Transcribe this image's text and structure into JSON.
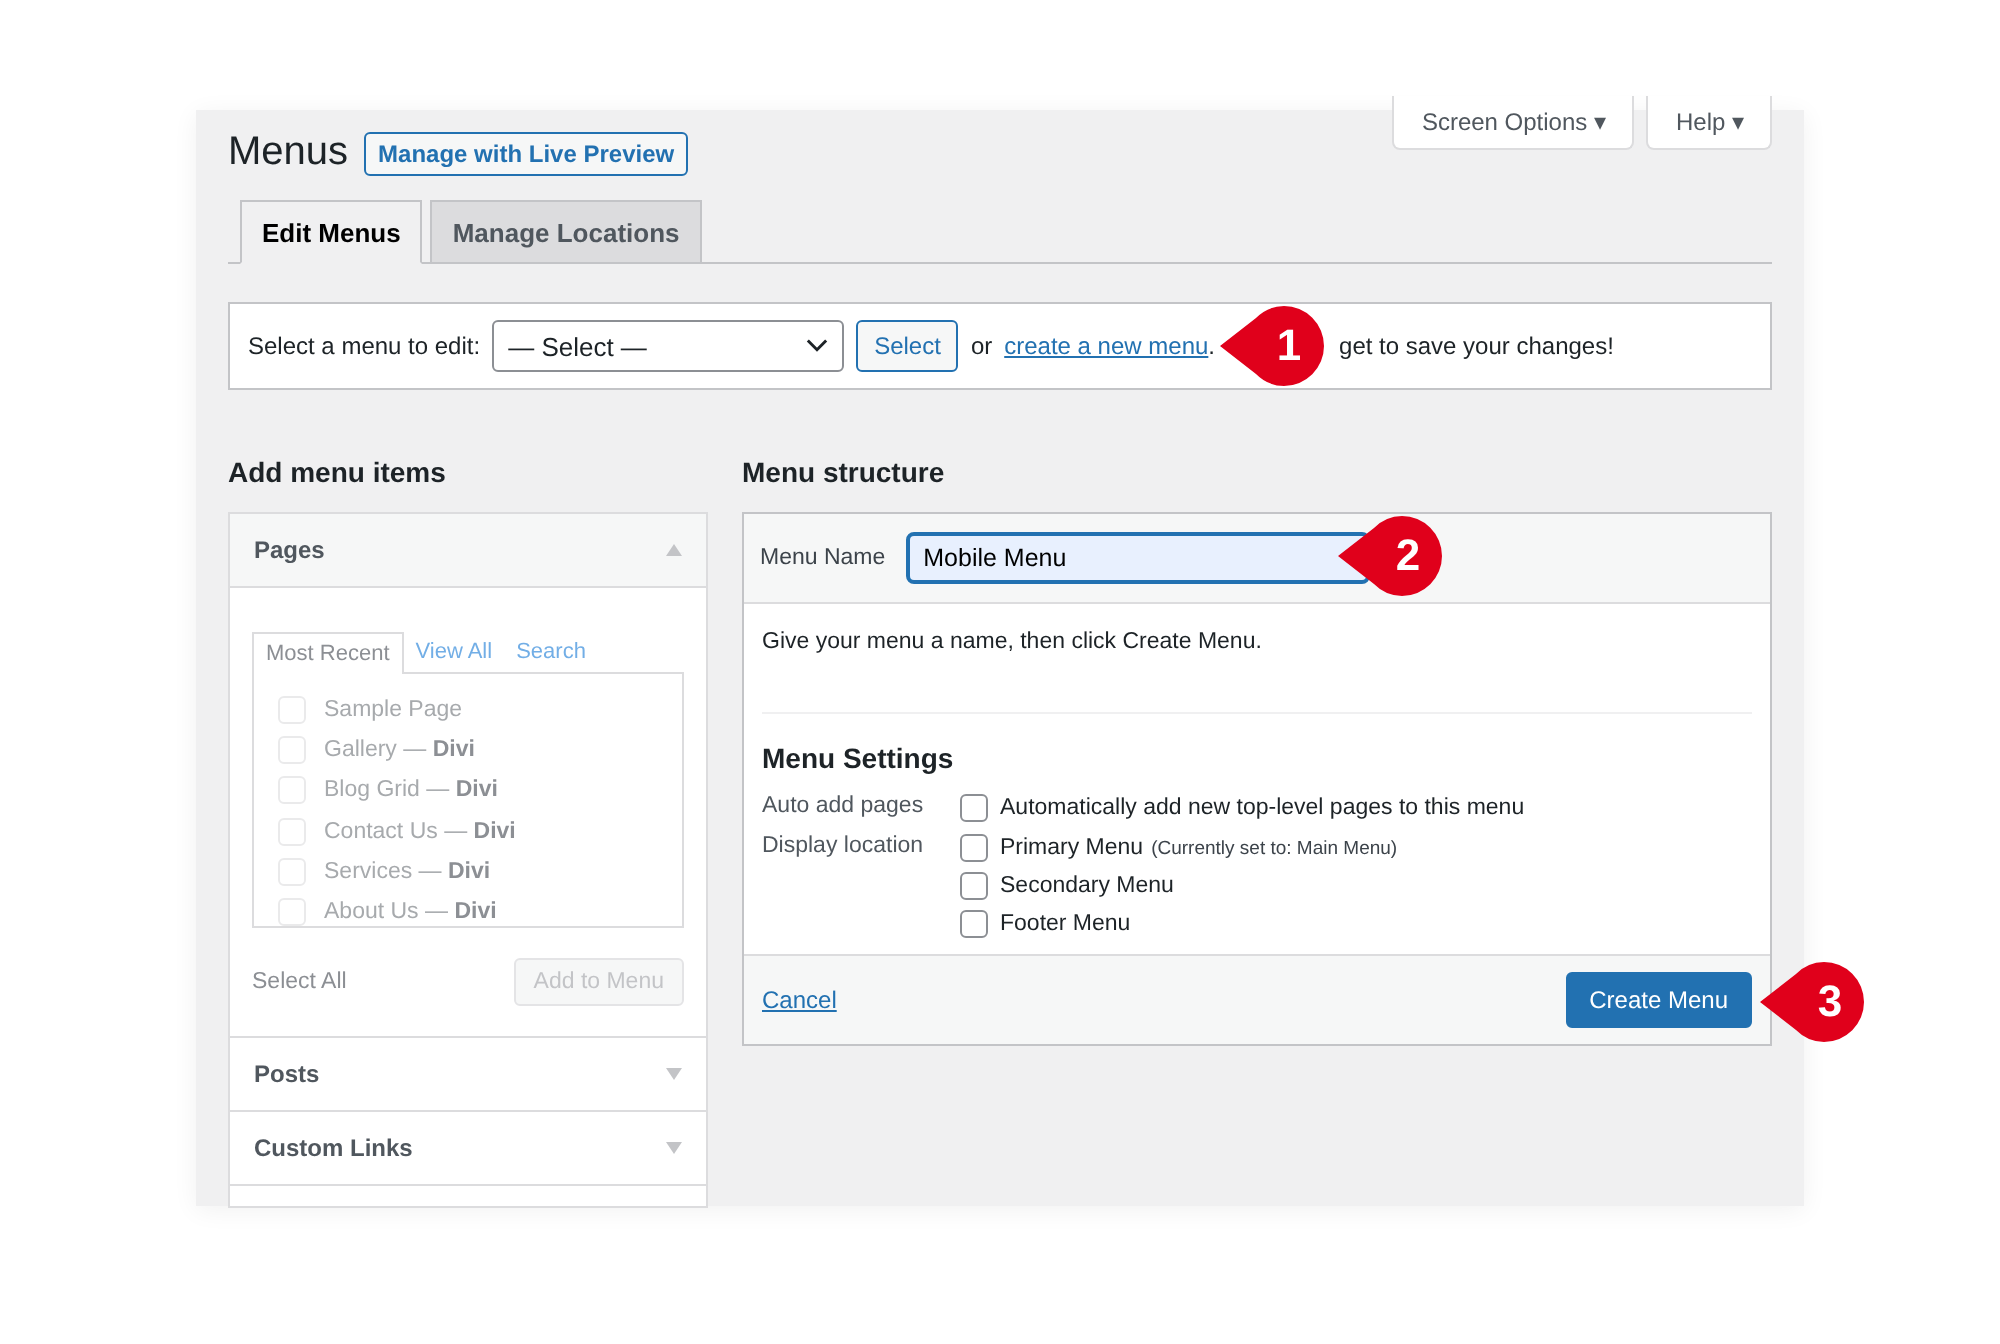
{
  "header": {
    "title": "Menus",
    "preview_button": "Manage with Live Preview",
    "screen_options": "Screen Options ▾",
    "help": "Help ▾"
  },
  "tabs": [
    {
      "label": "Edit Menus",
      "selected": true
    },
    {
      "label": "Manage Locations",
      "selected": false
    }
  ],
  "select_bar": {
    "label": "Select a menu to edit:",
    "dropdown": "— Select —",
    "button": "Select",
    "prefix": "or",
    "link": "create a new menu",
    "period": ".",
    "hidden_text": "get to save your changes!",
    "badge": "1"
  },
  "add_items": {
    "title": "Add menu items",
    "sections": [
      {
        "title": "Pages",
        "expanded": true
      },
      {
        "title": "Posts",
        "expanded": false
      },
      {
        "title": "Custom Links",
        "expanded": false
      }
    ],
    "subtabs": [
      {
        "label": "Most Recent",
        "selected": true
      },
      {
        "label": "View All",
        "selected": false
      },
      {
        "label": "Search",
        "selected": false
      }
    ],
    "pages": [
      {
        "label": "Sample Page",
        "checked": false
      },
      {
        "label": "Gallery — **Divi**",
        "checked": false
      },
      {
        "label": "Blog Grid — **Divi**",
        "checked": false
      },
      {
        "label": "Contact Us — **Divi**",
        "checked": false
      },
      {
        "label": "Services — **Divi**",
        "checked": false
      },
      {
        "label": "About Us — **Divi**",
        "checked": false
      }
    ],
    "select_all": "Select All",
    "add_button": "Add to Menu"
  },
  "structure": {
    "title": "Menu structure",
    "name_label": "Menu Name",
    "name_value": "Mobile Menu",
    "name_badge": "2",
    "hint": "Give your menu a name, then click Create Menu.",
    "settings_title": "Menu Settings",
    "settings": [
      {
        "label": "Auto add pages",
        "options": [
          {
            "label": "Automatically add new top-level pages to this menu",
            "checked": false
          }
        ]
      },
      {
        "label": "Display location",
        "options": [
          {
            "label": "Primary Menu",
            "note": "(Currently set to: Main Menu)",
            "checked": false
          },
          {
            "label": "Secondary Menu",
            "checked": false
          },
          {
            "label": "Footer Menu",
            "checked": false
          }
        ]
      }
    ],
    "cancel": "Cancel",
    "create_button": "Create Menu",
    "create_badge": "3"
  }
}
